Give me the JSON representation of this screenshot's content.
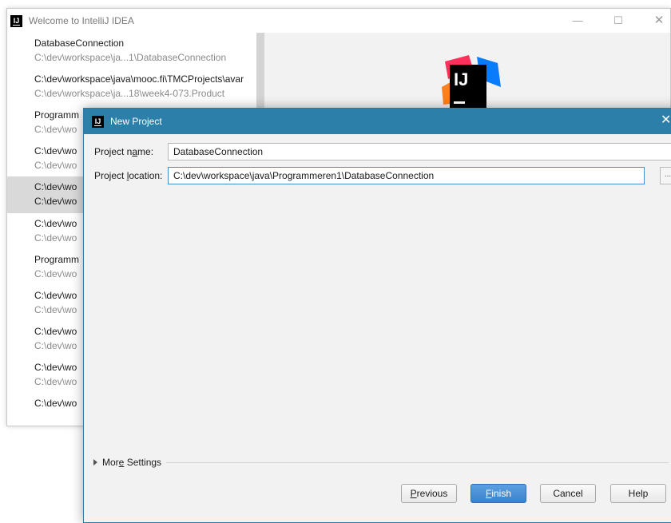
{
  "welcome": {
    "title": "Welcome to IntelliJ IDEA",
    "app_icon": "IJ",
    "window_controls": {
      "minimize": "—",
      "maximize": "☐",
      "close": "✕"
    },
    "recent_projects": [
      {
        "name": "DatabaseConnection",
        "path": "C:\\dev\\workspace\\ja...1\\DatabaseConnection"
      },
      {
        "name": "C:\\dev\\workspace\\java\\mooc.fi\\TMCProjects\\avar",
        "path": "C:\\dev\\workspace\\ja...18\\week4-073.Product"
      },
      {
        "name": "Programm",
        "path": "C:\\dev\\wo"
      },
      {
        "name": "C:\\dev\\wo",
        "path": "C:\\dev\\wo"
      },
      {
        "name": "C:\\dev\\wo",
        "path": "C:\\dev\\wo",
        "selected": true
      },
      {
        "name": "C:\\dev\\wo",
        "path": "C:\\dev\\wo"
      },
      {
        "name": "Programm",
        "path": "C:\\dev\\wo"
      },
      {
        "name": "C:\\dev\\wo",
        "path": "C:\\dev\\wo"
      },
      {
        "name": "C:\\dev\\wo",
        "path": "C:\\dev\\wo"
      },
      {
        "name": "C:\\dev\\wo",
        "path": "C:\\dev\\wo"
      },
      {
        "name": "C:\\dev\\wo",
        "path": ""
      }
    ],
    "logo_text": "IJ"
  },
  "dialog": {
    "title": "New Project",
    "app_icon": "IJ",
    "close": "✕",
    "project_name": {
      "label_pre": "Project n",
      "label_mn": "a",
      "label_post": "me:",
      "value": "DatabaseConnection"
    },
    "project_location": {
      "label_pre": "Project ",
      "label_mn": "l",
      "label_post": "ocation:",
      "value": "C:\\dev\\workspace\\java\\Programmeren1\\DatabaseConnection",
      "browse": "..."
    },
    "more_settings": {
      "pre": "Mor",
      "mn": "e",
      "post": " Settings"
    },
    "buttons": {
      "previous": {
        "mn": "P",
        "rest": "revious"
      },
      "finish": {
        "mn": "F",
        "rest": "inish"
      },
      "cancel": "Cancel",
      "help": "Help"
    }
  },
  "colors": {
    "dialog_titlebar": "#2b7fa9",
    "finish_button": "#3b82cc",
    "selection": "#d9d9d9"
  }
}
